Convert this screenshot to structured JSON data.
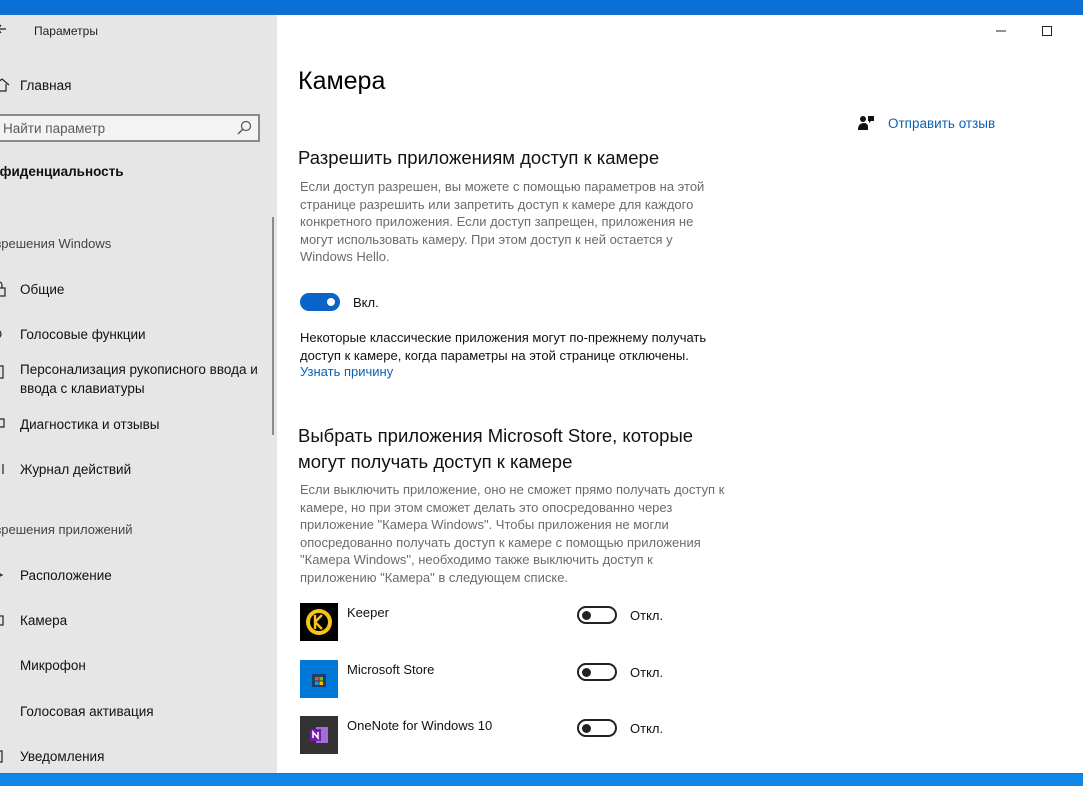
{
  "window": {
    "title": "Параметры",
    "controls": {
      "minimize": "—",
      "maximize": "☐",
      "close": "✕"
    }
  },
  "sidebar": {
    "home_label": "Главная",
    "search_placeholder": "Найти параметр",
    "section_heading": "Конфиденциальность",
    "groups": [
      {
        "label": "Разрешения Windows",
        "items": [
          {
            "label": "Общие",
            "icon": "lock-icon"
          },
          {
            "label": "Голосовые функции",
            "icon": "speech-icon"
          },
          {
            "label": "Персонализация рукописного ввода и ввода с клавиатуры",
            "icon": "pen-icon"
          },
          {
            "label": "Диагностика и отзывы",
            "icon": "feedback-icon"
          },
          {
            "label": "Журнал действий",
            "icon": "history-icon"
          }
        ]
      },
      {
        "label": "Разрешения приложений",
        "items": [
          {
            "label": "Расположение",
            "icon": "location-icon"
          },
          {
            "label": "Камера",
            "icon": "camera-icon"
          },
          {
            "label": "Микрофон",
            "icon": "microphone-icon"
          },
          {
            "label": "Голосовая активация",
            "icon": "voice-activation-icon"
          },
          {
            "label": "Уведомления",
            "icon": "notifications-icon"
          }
        ]
      }
    ]
  },
  "main": {
    "page_title": "Камера",
    "feedback_link": "Отправить отзыв",
    "access_section": {
      "heading": "Разрешить приложениям доступ к камере",
      "description": "Если доступ разрешен, вы можете с помощью параметров на этой странице разрешить или запретить доступ к камере для каждого конкретного приложения. Если доступ запрещен, приложения не могут использовать камеру. При этом доступ к ней остается у Windows Hello.",
      "toggle_state": "Вкл.",
      "toggle_on": true,
      "note": "Некоторые классические приложения могут по-прежнему получать доступ к камере, когда параметры на этой странице отключены.",
      "learn_link": "Узнать причину"
    },
    "store_section": {
      "heading": "Выбрать приложения Microsoft Store, которые могут получать доступ к камере",
      "description": "Если выключить приложение, оно не сможет прямо получать доступ к камере, но при этом сможет делать это опосредованно через приложение \"Камера Windows\". Чтобы приложения не могли опосредованно получать доступ к камере с помощью приложения \"Камера Windows\", необходимо также выключить доступ к приложению \"Камера\" в следующем списке.",
      "apps": [
        {
          "name": "Keeper",
          "state": "Откл.",
          "on": false,
          "icon": "keeper-icon",
          "icon_bg": "#000000"
        },
        {
          "name": "Microsoft Store",
          "state": "Откл.",
          "on": false,
          "icon": "microsoft-store-icon",
          "icon_bg": "#0078d7"
        },
        {
          "name": "OneNote for Windows 10",
          "state": "Откл.",
          "on": false,
          "icon": "onenote-icon",
          "icon_bg": "#333333"
        }
      ]
    }
  },
  "colors": {
    "accent": "#0a63c6",
    "link": "#0b61b3",
    "sidebar_bg": "#e6e6e6",
    "desktop": "#0f86e8"
  }
}
